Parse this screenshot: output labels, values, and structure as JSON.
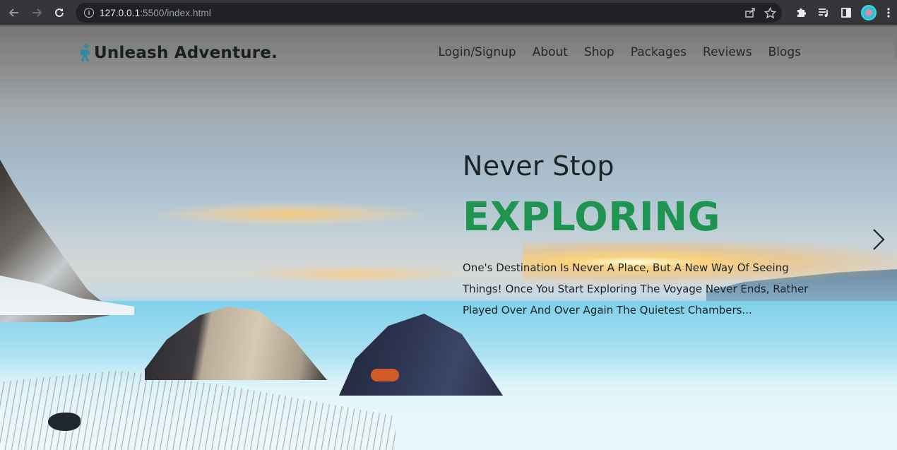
{
  "browser": {
    "url_host": "127.0.0.1",
    "url_rest": ":5500/index.html",
    "icons": {
      "back": "arrow-left-icon",
      "forward": "arrow-right-icon",
      "reload": "reload-icon",
      "info": "info-icon",
      "share": "share-icon",
      "bookmark": "star-icon",
      "extensions": "puzzle-icon",
      "media": "media-queue-icon",
      "sidepanel": "side-panel-icon",
      "menu": "kebab-menu-icon"
    }
  },
  "site": {
    "logo_text": "Unleash Adventure.",
    "nav": [
      {
        "label": "Login/Signup"
      },
      {
        "label": "About"
      },
      {
        "label": "Shop"
      },
      {
        "label": "Packages"
      },
      {
        "label": "Reviews"
      },
      {
        "label": "Blogs"
      }
    ]
  },
  "hero": {
    "kicker": "Never Stop",
    "headline": "EXPLORING",
    "lede": "One's Destination Is Never A Place, But A New Way Of Seeing Things! Once You Start Exploring The Voyage Never Ends, Rather Played Over And Over Again The Quietest Chambers..."
  },
  "colors": {
    "accent_green": "#1e9450",
    "chrome_bg": "#35363a",
    "omnibox_bg": "#202124"
  }
}
